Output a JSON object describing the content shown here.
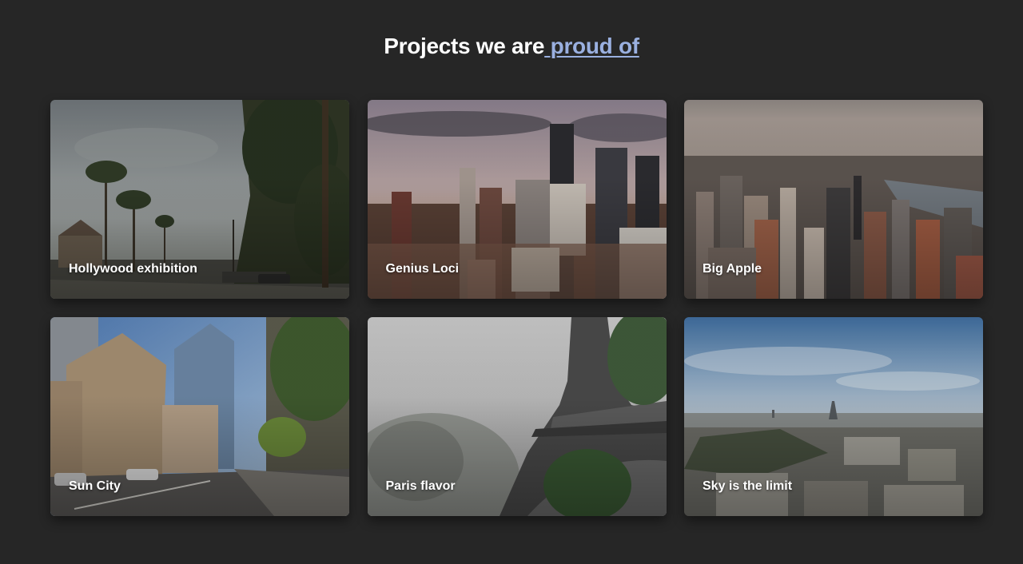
{
  "header": {
    "title_prefix": "Projects we are",
    "title_link": " proud of",
    "link_color": "#9ab0e0"
  },
  "projects": [
    {
      "title": "Hollywood exhibition",
      "image": "palm-street-photo"
    },
    {
      "title": "Genius Loci",
      "image": "city-skyline-photo"
    },
    {
      "title": "Big Apple",
      "image": "aerial-city-photo"
    },
    {
      "title": "Sun City",
      "image": "street-buildings-photo"
    },
    {
      "title": "Paris flavor",
      "image": "eiffel-tower-photo"
    },
    {
      "title": "Sky is the limit",
      "image": "paris-panorama-photo"
    }
  ]
}
